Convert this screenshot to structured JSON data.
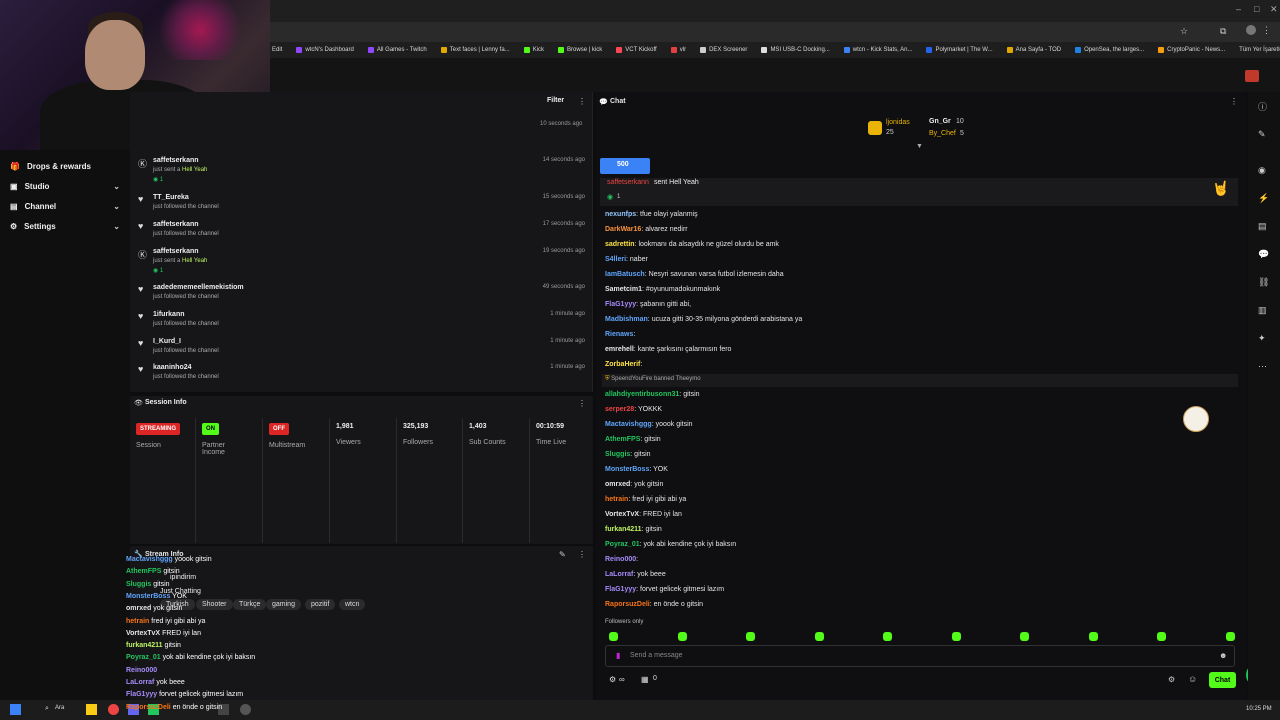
{
  "browser": {
    "bookmarks": [
      {
        "label": "wtcN's Dashboard",
        "color": "#9146ff"
      },
      {
        "label": "All Games - Twitch",
        "color": "#9146ff"
      },
      {
        "label": "Text faces | Lenny fa...",
        "color": "#e0a800"
      },
      {
        "label": "Kick",
        "color": "#53fc18"
      },
      {
        "label": "Browse | kick",
        "color": "#53fc18"
      },
      {
        "label": "VCT Kickoff",
        "color": "#ff4655"
      },
      {
        "label": "vlr",
        "color": "#e24040"
      },
      {
        "label": "DEX Screener",
        "color": "#cccccc"
      },
      {
        "label": "MSI USB-C Docking...",
        "color": "#dddddd"
      },
      {
        "label": "wtcn - Kick Stats, An...",
        "color": "#3b82f6"
      },
      {
        "label": "Polymarket | The W...",
        "color": "#2563eb"
      },
      {
        "label": "Ana Sayfa - TOD",
        "color": "#e0a800"
      },
      {
        "label": "OpenSea, the larges...",
        "color": "#2081e2"
      },
      {
        "label": "CryptoPanic - News...",
        "color": "#f59e0b"
      }
    ],
    "all_bookmarks": "Tüm Yer İşaretleri",
    "left_partial": "Edit"
  },
  "sidebar": {
    "items": [
      {
        "label": "Drops & rewards",
        "icon": "gift-icon",
        "expandable": false
      },
      {
        "label": "Studio",
        "icon": "studio-icon",
        "expandable": true
      },
      {
        "label": "Channel",
        "icon": "channel-icon",
        "expandable": true
      },
      {
        "label": "Settings",
        "icon": "gear-icon",
        "expandable": true
      }
    ]
  },
  "activity": {
    "filter_label": "Filter",
    "first_time": "10 seconds ago",
    "rows": [
      {
        "icon": "kick-icon",
        "user": "saffetserkann",
        "action": "just sent a",
        "gift": "Hell Yeah",
        "count": "1",
        "time": "14 seconds ago"
      },
      {
        "icon": "heart-icon",
        "user": "TT_Eureka",
        "action": "just followed the channel",
        "gift": "",
        "count": "",
        "time": "15 seconds ago"
      },
      {
        "icon": "heart-icon",
        "user": "saffetserkann",
        "action": "just followed the channel",
        "gift": "",
        "count": "",
        "time": "17 seconds ago"
      },
      {
        "icon": "kick-icon",
        "user": "saffetserkann",
        "action": "just sent a",
        "gift": "Hell Yeah",
        "count": "1",
        "time": "19 seconds ago"
      },
      {
        "icon": "heart-icon",
        "user": "sadedememeellemekistiom",
        "action": "just followed the channel",
        "gift": "",
        "count": "",
        "time": "49 seconds ago"
      },
      {
        "icon": "heart-icon",
        "user": "1ifurkann",
        "action": "just followed the channel",
        "gift": "",
        "count": "",
        "time": "1 minute ago"
      },
      {
        "icon": "heart-icon",
        "user": "I_Kurd_I",
        "action": "just followed the channel",
        "gift": "",
        "count": "",
        "time": "1 minute ago"
      },
      {
        "icon": "heart-icon",
        "user": "kaaninho24",
        "action": "just followed the channel",
        "gift": "",
        "count": "",
        "time": "1 minute ago"
      }
    ]
  },
  "session": {
    "title": "Session Info",
    "streaming_badge": "STREAMING",
    "session_label": "Session",
    "partner_badge": "ON",
    "partner_label": "Partner Income",
    "multi_badge": "OFF",
    "multi_label": "Multistream",
    "viewers": "1,981",
    "viewers_label": "Viewers",
    "followers": "325,193",
    "followers_label": "Followers",
    "subs": "1,403",
    "subs_label": "Sub Counts",
    "time_live": "00:10:59",
    "time_live_label": "Time Live"
  },
  "stream_info": {
    "title": "Stream Info",
    "stream_title_line": "ipindirim",
    "category": "Just Chatting",
    "tags": [
      "Turkish",
      "Shooter",
      "Türkçe",
      "gaming",
      "pozitif",
      "wtcn"
    ],
    "overlay_lines": [
      {
        "name": "Mactavishggg",
        "color": "#60a5fa",
        "msg": "yoook gitsin"
      },
      {
        "name": "AthemFPS",
        "color": "#22c55e",
        "msg": "gitsin"
      },
      {
        "name": "Sluggis",
        "color": "#22c55e",
        "msg": "gitsin"
      },
      {
        "name": "MonsterBoss",
        "color": "#60a5fa",
        "msg": "YOK"
      },
      {
        "name": "omrxed",
        "color": "#e5e5e5",
        "msg": "yok gitsin"
      },
      {
        "name": "hetrain",
        "color": "#f97316",
        "msg": "fred iyi gibi abi ya"
      },
      {
        "name": "VortexTvX",
        "color": "#e5e5e5",
        "msg": "FRED iyi lan"
      },
      {
        "name": "furkan4211",
        "color": "#bef264",
        "msg": "gitsin"
      },
      {
        "name": "Poyraz_01",
        "color": "#22c55e",
        "msg": "yok abi kendine çok iyi baksın"
      },
      {
        "name": "Reino000",
        "color": "#a78bfa",
        "msg": ""
      },
      {
        "name": "LaLorraf",
        "color": "#a78bfa",
        "msg": "yok beee"
      },
      {
        "name": "FlaG1yyy",
        "color": "#a78bfa",
        "msg": "forvet gelicek gitmesi lazım"
      },
      {
        "name": "RaporsuzDeli",
        "color": "#f97316",
        "msg": "en önde o gitsin"
      }
    ]
  },
  "chat": {
    "title": "Chat",
    "top_gifters": [
      {
        "name": "ljonidas",
        "value": "25"
      },
      {
        "name": "Gn_Gr",
        "value": "10"
      },
      {
        "name": "By_Chef",
        "value": "5"
      }
    ],
    "goal_value": "500",
    "pinned": {
      "name": "saffetserkann",
      "msg": "sent Hell Yeah",
      "count": "1"
    },
    "messages": [
      {
        "name": "nexunfps",
        "color": "#93c5fd",
        "msg": "tfue olayi yalanmiş"
      },
      {
        "name": "DarkWar16",
        "color": "#fb923c",
        "msg": "alvarez nedirr"
      },
      {
        "name": "sadrettin",
        "color": "#fde047",
        "msg": "lookmanı da alsaydık ne güzel olurdu be amk"
      },
      {
        "name": "S4lleri",
        "color": "#60a5fa",
        "msg": "naber"
      },
      {
        "name": "IamBatusch",
        "color": "#60a5fa",
        "msg": "Nesyri savunan varsa futbol izlemesin daha"
      },
      {
        "name": "Sametcim1",
        "color": "#e5e5e5",
        "msg": "#oyunumadokunmakınk"
      },
      {
        "name": "FlaG1yyy",
        "color": "#a78bfa",
        "msg": "şabanın gitti abi,"
      },
      {
        "name": "Madbishman",
        "color": "#60a5fa",
        "msg": "ucuza gitti 30-35 milyona gönderdi arabistana ya"
      },
      {
        "name": "Rienaws",
        "color": "#60a5fa",
        "msg": ""
      },
      {
        "name": "emrehell",
        "color": "#e5e5e5",
        "msg": "kante şarkısını çalarmısın fero"
      },
      {
        "name": "ZorbaHerif",
        "color": "#fde047",
        "msg": ""
      },
      {
        "name": "SpeendYouFire banned Theeymo",
        "color": "#aaaaaa",
        "msg": ""
      },
      {
        "name": "allahdiyentirbusonn31",
        "color": "#22c55e",
        "msg": "gitsin"
      },
      {
        "name": "serper28",
        "color": "#ef4444",
        "msg": "YOKKK"
      },
      {
        "name": "Mactavishggg",
        "color": "#60a5fa",
        "msg": "yoook gitsin"
      },
      {
        "name": "AthemFPS",
        "color": "#22c55e",
        "msg": "gitsin"
      },
      {
        "name": "Sluggis",
        "color": "#22c55e",
        "msg": "gitsin"
      },
      {
        "name": "MonsterBoss",
        "color": "#60a5fa",
        "msg": "YOK"
      },
      {
        "name": "omrxed",
        "color": "#e5e5e5",
        "msg": "yok gitsin"
      },
      {
        "name": "hetrain",
        "color": "#f97316",
        "msg": "fred iyi gibi abi ya"
      },
      {
        "name": "VortexTvX",
        "color": "#e5e5e5",
        "msg": "FRED iyi lan"
      },
      {
        "name": "furkan4211",
        "color": "#bef264",
        "msg": "gitsin"
      },
      {
        "name": "Poyraz_01",
        "color": "#22c55e",
        "msg": "yok abi kendine çok iyi baksın"
      },
      {
        "name": "Reino000",
        "color": "#a78bfa",
        "msg": ""
      },
      {
        "name": "LaLorraf",
        "color": "#a78bfa",
        "msg": "yok beee"
      },
      {
        "name": "FlaG1yyy",
        "color": "#a78bfa",
        "msg": "forvet gelicek gitmesi lazım"
      },
      {
        "name": "RaporsuzDeli",
        "color": "#f97316",
        "msg": "en önde o gitsin"
      }
    ],
    "followers_only": "Followers only",
    "input_placeholder": "Send a message",
    "infinity_label": "∞",
    "counter": "0",
    "send_label": "Chat"
  },
  "taskbar": {
    "search_label": "Ara",
    "clock": "10:25 PM"
  }
}
